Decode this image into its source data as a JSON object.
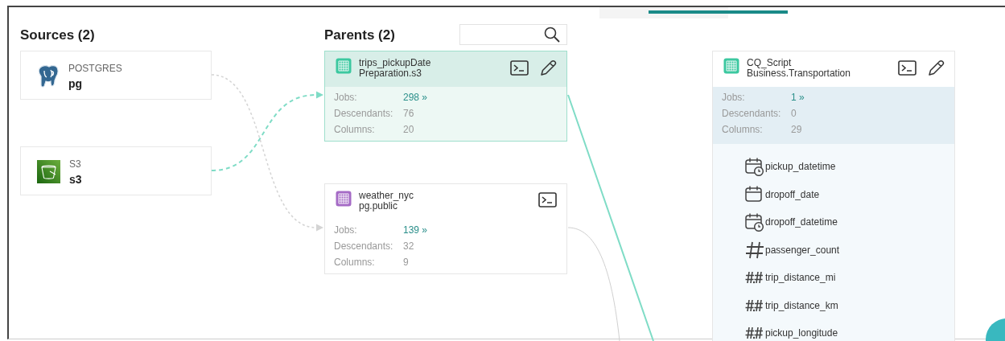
{
  "sources": {
    "title": "Sources (2)",
    "items": [
      {
        "kind": "postgres",
        "type": "POSTGRES",
        "name": "pg"
      },
      {
        "kind": "s3",
        "type": "S3",
        "name": "s3"
      }
    ]
  },
  "parents": {
    "title": "Parents (2)",
    "items": [
      {
        "title": "trips_pickupDate",
        "subtitle": "Preparation.s3",
        "color": "#3cc8a0",
        "selected": true,
        "editable": true,
        "stats": [
          {
            "label": "Jobs:",
            "value": "298 »",
            "kind": "link"
          },
          {
            "label": "Descendants:",
            "value": "76",
            "kind": "plain"
          },
          {
            "label": "Columns:",
            "value": "20",
            "kind": "plain"
          }
        ]
      },
      {
        "title": "weather_nyc",
        "subtitle": "pg.public",
        "color": "#a56bc6",
        "selected": false,
        "editable": false,
        "stats": [
          {
            "label": "Jobs:",
            "value": "139 »",
            "kind": "link"
          },
          {
            "label": "Descendants:",
            "value": "32",
            "kind": "plain"
          },
          {
            "label": "Columns:",
            "value": "9",
            "kind": "plain"
          }
        ]
      }
    ]
  },
  "target": {
    "title": "CQ_Script",
    "subtitle": "Business.Transportation",
    "color": "#3cc8a0",
    "editable": true,
    "stats": [
      {
        "label": "Jobs:",
        "value": "1 »",
        "kind": "link"
      },
      {
        "label": "Descendants:",
        "value": "0",
        "kind": "plain"
      },
      {
        "label": "Columns:",
        "value": "29",
        "kind": "plain"
      }
    ],
    "columns": [
      {
        "kind": "datetime",
        "name": "pickup_datetime"
      },
      {
        "kind": "date",
        "name": "dropoff_date"
      },
      {
        "kind": "datetime",
        "name": "dropoff_datetime"
      },
      {
        "kind": "integer",
        "name": "passenger_count"
      },
      {
        "kind": "decimal",
        "name": "trip_distance_mi"
      },
      {
        "kind": "decimal",
        "name": "trip_distance_km"
      },
      {
        "kind": "decimal",
        "name": "pickup_longitude"
      }
    ]
  }
}
